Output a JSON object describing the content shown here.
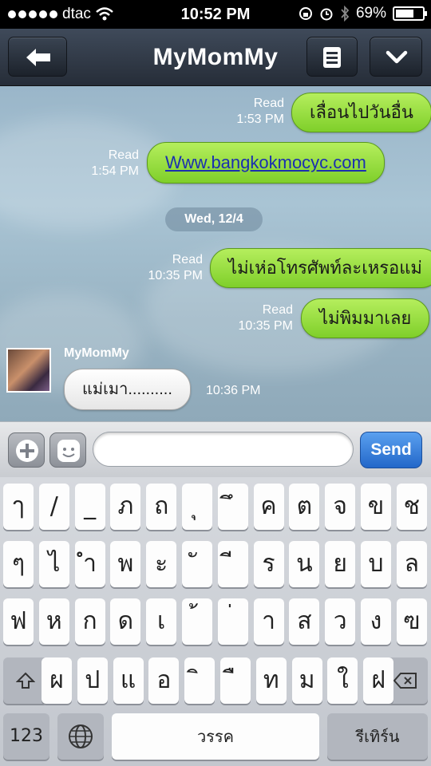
{
  "status_bar": {
    "carrier": "dtac",
    "time": "10:52 PM",
    "battery": "69%",
    "battery_level": 0.69,
    "icons": [
      "signal-dots-icon",
      "wifi-icon",
      "orientation-lock-icon",
      "alarm-icon",
      "bluetooth-icon",
      "battery-icon"
    ]
  },
  "nav": {
    "title": "MyMomMy",
    "back_icon": "back-arrow-icon",
    "menu_icon": "menu-list-icon",
    "expand_icon": "chevron-down-icon"
  },
  "chat": {
    "messages_out_1": {
      "text": "เลื่อนไปวันอื่น",
      "status": "Read",
      "time": "1:53 PM"
    },
    "messages_out_2": {
      "text": "Www.bangkokmocyc.com",
      "status": "Read",
      "time": "1:54 PM"
    },
    "date_divider": "Wed, 12/4",
    "messages_out_3": {
      "text": "ไม่เห่อโทรศัพท์ละเหรอแม่",
      "status": "Read",
      "time": "10:35 PM"
    },
    "messages_out_4": {
      "text": "ไม่พิมมาเลย",
      "status": "Read",
      "time": "10:35 PM"
    },
    "incoming": {
      "sender": "MyMomMy",
      "text": "แม่เมา..........",
      "time": "10:36 PM"
    },
    "colors": {
      "outgoing_bubble": "#9ee045",
      "incoming_bubble": "#ffffff",
      "link": "#1b2fb0"
    }
  },
  "input_bar": {
    "plus_icon": "plus-icon",
    "emoji_icon": "emoji-face-icon",
    "message_value": "",
    "send_label": "Send",
    "send_color": "#3a82dd"
  },
  "keyboard": {
    "row1": [
      "ๅ",
      "/",
      "_",
      "ภ",
      "ถ",
      "ุ",
      "ึ",
      "ค",
      "ต",
      "จ",
      "ข",
      "ช"
    ],
    "row2": [
      "ๆ",
      "ไ",
      "ำ",
      "พ",
      "ะ",
      "ั",
      "ี",
      "ร",
      "น",
      "ย",
      "บ",
      "ล"
    ],
    "row3": [
      "ฟ",
      "ห",
      "ก",
      "ด",
      "เ",
      "้",
      "่",
      "า",
      "ส",
      "ว",
      "ง",
      "ฃ"
    ],
    "row4": [
      "ผ",
      "ป",
      "แ",
      "อ",
      "ิ",
      "ื",
      "ท",
      "ม",
      "ใ",
      "ฝ"
    ],
    "shift_icon": "shift-arrow-icon",
    "delete_icon": "delete-backspace-icon",
    "numbers_label": "123",
    "globe_icon": "globe-icon",
    "space_label": "วรรค",
    "return_label": "รีเทิร์น"
  }
}
